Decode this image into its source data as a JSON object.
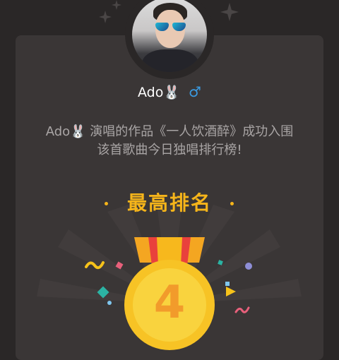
{
  "profile": {
    "name": "Ado🐰",
    "gender_symbol": "♂"
  },
  "message": {
    "line1": "Ado🐰 演唱的作品《一人饮酒醉》成功入围",
    "line2": "该首歌曲今日独唱排行榜!"
  },
  "ranking": {
    "title": "最高排名",
    "rank": "4"
  },
  "colors": {
    "accent": "#f6b51a",
    "gender": "#3a9be2",
    "background": "#2a2727",
    "card": "#3a3636"
  },
  "icons": [
    "sparkle-icon",
    "gender-male-icon",
    "medal-icon",
    "confetti-icon"
  ]
}
